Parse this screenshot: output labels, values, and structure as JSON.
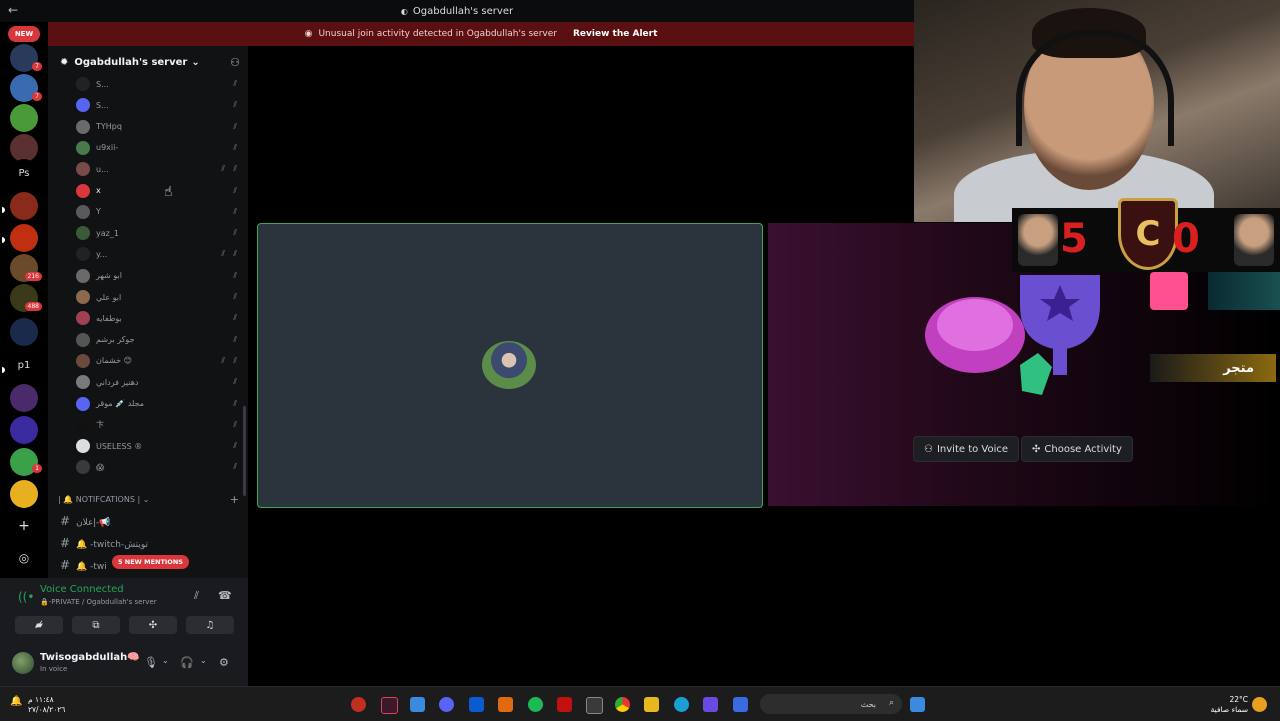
{
  "window": {
    "title": "Ogabdullah's server"
  },
  "alert": {
    "message": "Unusual join activity detected in Ogabdullah's server",
    "action": "Review the Alert"
  },
  "rail": {
    "new_badge": "NEW",
    "badges": [
      "7",
      "7",
      "216",
      "488",
      "1"
    ],
    "text_icons": [
      "Ps",
      "p1"
    ]
  },
  "server": {
    "name": "Ogabdullah's server"
  },
  "members": [
    {
      "name": "S..."
    },
    {
      "name": "S..."
    },
    {
      "name": "TYHpq"
    },
    {
      "name": "u9xii-"
    },
    {
      "name": "u..."
    },
    {
      "name": "x"
    },
    {
      "name": "Y"
    },
    {
      "name": "yaz_1"
    },
    {
      "name": "y..."
    },
    {
      "name": "ابو شهر"
    },
    {
      "name": "ابو علي"
    },
    {
      "name": "بوطفايه"
    },
    {
      "name": "جوكر برشم"
    },
    {
      "name": "خشمان 😊"
    },
    {
      "name": "دهنيز فرداني"
    },
    {
      "name": "مجلد 💉 موقر"
    },
    {
      "name": "卞"
    },
    {
      "name": "USELESS ®"
    },
    {
      "name": "😱"
    }
  ],
  "category": {
    "label": "| 🔔 NOTIFCATIONS |"
  },
  "channels": [
    {
      "name": "إعلان-📢"
    },
    {
      "name": "🔔 -twitch-تويتش"
    },
    {
      "name": "🔔 -twi"
    }
  ],
  "mentions_pill": "5 NEW MENTIONS",
  "voice": {
    "status": "Voice Connected",
    "sub": "🔒-PRIVATE / Ogabdullah's server"
  },
  "user": {
    "name": "Twisogabdullah🧠",
    "status": "In voice"
  },
  "activity": {
    "store_label": "متجر",
    "invite_label": "Invite to Voice",
    "choose_label": "Choose Activity"
  },
  "scoreboard": {
    "left_score": "5",
    "right_score": "0",
    "crest": "C"
  },
  "taskbar": {
    "time": "١١:٤٨ م",
    "date": "٢٧/٠٨/٢٠٢٦",
    "search": "بحث",
    "temp": "22°C",
    "weather": "سماء صافية"
  }
}
